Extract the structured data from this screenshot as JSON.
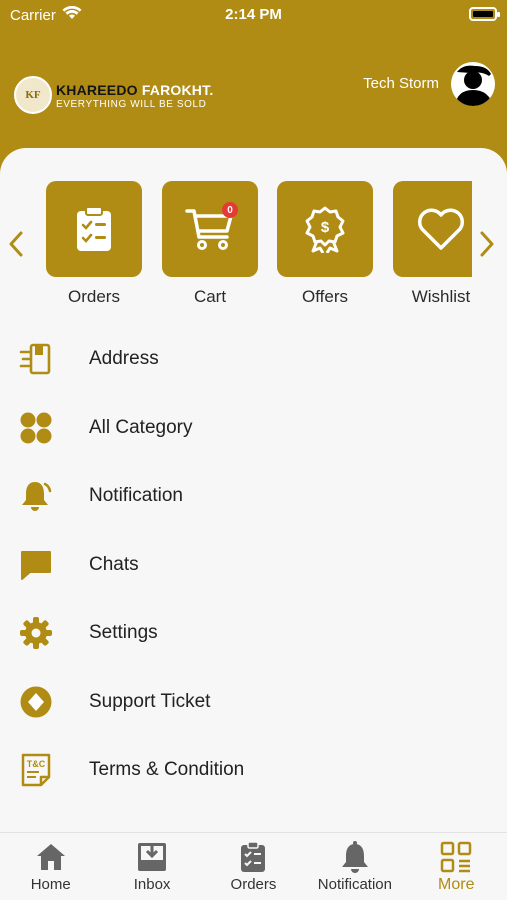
{
  "status_bar": {
    "carrier": "Carrier",
    "time": "2:14 PM"
  },
  "header": {
    "brand_part1": "KHAREEDO",
    "brand_part2": "FAROKHT.",
    "tagline": "EVERYTHING WILL BE SOLD",
    "logo_mark": "KF",
    "user_name": "Tech Storm"
  },
  "quick_actions": [
    {
      "label": "Orders",
      "icon": "clipboard-checklist-icon"
    },
    {
      "label": "Cart",
      "icon": "cart-icon",
      "badge": "0"
    },
    {
      "label": "Offers",
      "icon": "offer-badge-icon"
    },
    {
      "label": "Wishlist",
      "icon": "heart-icon"
    }
  ],
  "menu": [
    {
      "label": "Address",
      "icon": "address-book-icon"
    },
    {
      "label": "All Category",
      "icon": "grid-dots-icon"
    },
    {
      "label": "Notification",
      "icon": "bell-icon"
    },
    {
      "label": "Chats",
      "icon": "chat-bubble-icon"
    },
    {
      "label": "Settings",
      "icon": "gear-icon"
    },
    {
      "label": "Support Ticket",
      "icon": "ticket-icon"
    },
    {
      "label": "Terms & Condition",
      "icon": "terms-doc-icon"
    }
  ],
  "tabs": [
    {
      "label": "Home",
      "icon": "home-icon"
    },
    {
      "label": "Inbox",
      "icon": "inbox-icon"
    },
    {
      "label": "Orders",
      "icon": "clipboard-icon"
    },
    {
      "label": "Notification",
      "icon": "bell-icon"
    },
    {
      "label": "More",
      "icon": "more-grid-icon",
      "active": true
    }
  ],
  "colors": {
    "accent": "#b08c14",
    "sheet_bg": "#f7f7f7",
    "badge": "#e53935"
  }
}
